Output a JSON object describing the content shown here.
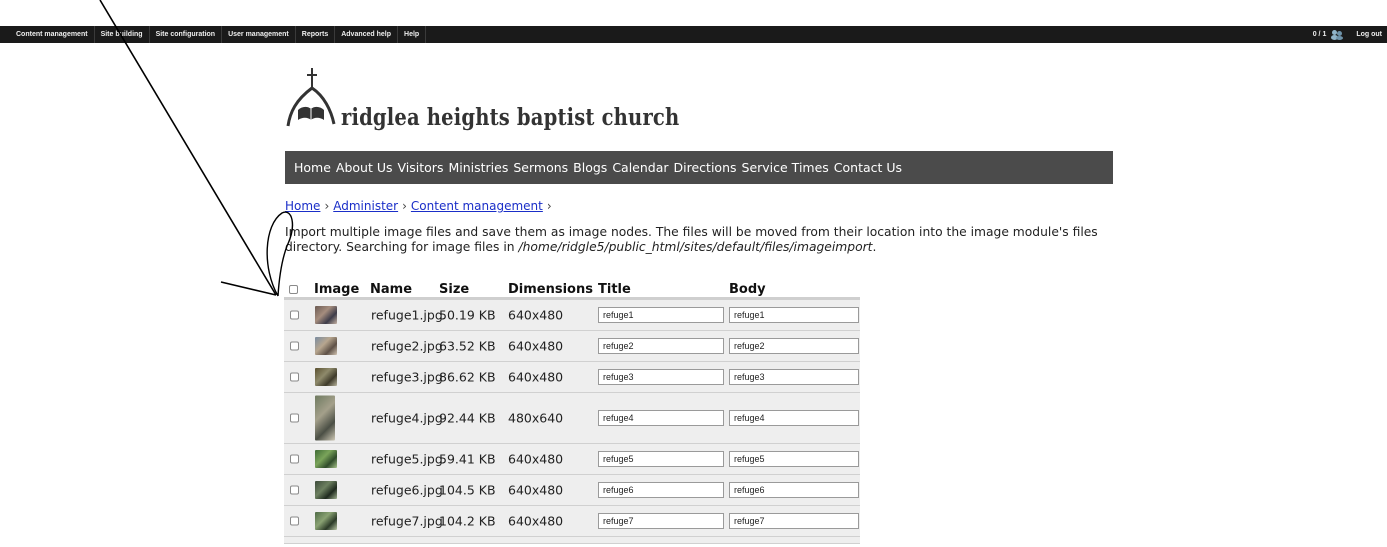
{
  "admin_bar": {
    "items": [
      "Content management",
      "Site building",
      "Site configuration",
      "User management",
      "Reports",
      "Advanced help",
      "Help"
    ],
    "users_count": "0 / 1",
    "logout": "Log out"
  },
  "site": {
    "name": "ridglea heights baptist church"
  },
  "nav": [
    "Home",
    "About Us",
    "Visitors",
    "Ministries",
    "Sermons",
    "Blogs",
    "Calendar",
    "Directions",
    "Service Times",
    "Contact Us"
  ],
  "breadcrumb": [
    "Home",
    "Administer",
    "Content management"
  ],
  "help": {
    "text": "Import multiple image files and save them as image nodes. The files will be moved from their location into the image module's files directory. Searching for image files in ",
    "path": "/home/ridgle5/public_html/sites/default/files/imageimport",
    "end": "."
  },
  "table": {
    "headers": [
      "Image",
      "Name",
      "Size",
      "Dimensions",
      "Title",
      "Body"
    ],
    "rows": [
      {
        "name": "refuge1.jpg",
        "size": "50.19 KB",
        "dims": "640x480",
        "title": "refuge1",
        "body": "refuge1"
      },
      {
        "name": "refuge2.jpg",
        "size": "63.52 KB",
        "dims": "640x480",
        "title": "refuge2",
        "body": "refuge2"
      },
      {
        "name": "refuge3.jpg",
        "size": "86.62 KB",
        "dims": "640x480",
        "title": "refuge3",
        "body": "refuge3"
      },
      {
        "name": "refuge4.jpg",
        "size": "92.44 KB",
        "dims": "480x640",
        "title": "refuge4",
        "body": "refuge4"
      },
      {
        "name": "refuge5.jpg",
        "size": "59.41 KB",
        "dims": "640x480",
        "title": "refuge5",
        "body": "refuge5"
      },
      {
        "name": "refuge6.jpg",
        "size": "104.5 KB",
        "dims": "640x480",
        "title": "refuge6",
        "body": "refuge6"
      },
      {
        "name": "refuge7.jpg",
        "size": "104.2 KB",
        "dims": "640x480",
        "title": "refuge7",
        "body": "refuge7"
      }
    ]
  },
  "colors": {
    "admin_bar": "#1a1a1a",
    "nav_bar": "#4b4b4b",
    "link": "#1a2ec8",
    "row_bg": "#eeeeee"
  }
}
